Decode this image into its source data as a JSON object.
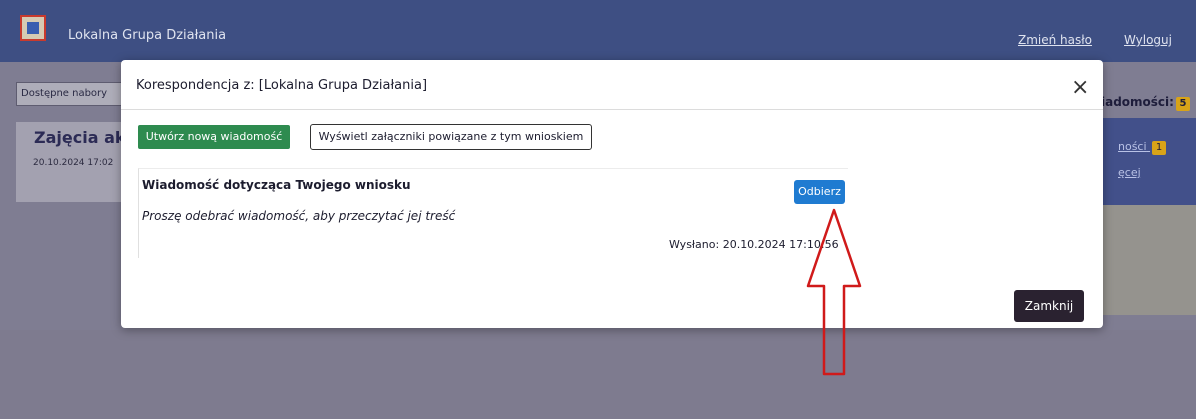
{
  "app": {
    "title": "Lokalna Grupa Działania",
    "change_password": "Zmień hasło",
    "logout": "Wyloguj"
  },
  "background": {
    "nav_button": "Dostępne nabory",
    "card_title": "Zajęcia akty",
    "card_date": "20.10.2024 17:02",
    "messages_label": "iadomości:",
    "messages_badge": "5",
    "side_link1": "ności",
    "side_link1_badge": "1",
    "side_link2": "ęcej"
  },
  "modal": {
    "title": "Korespondencja z: [Lokalna Grupa Działania]",
    "close_symbol": "×",
    "new_message_button": "Utwórz nową wiadomość",
    "attachments_button": "Wyświetl załączniki powiązane z tym wnioskiem",
    "message": {
      "subject": "Wiadomość dotycząca Twojego wniosku",
      "hint": "Proszę odebrać wiadomość, aby przeczytać jej treść",
      "receive_button": "Odbierz",
      "sent": "Wysłano: 20.10.2024 17:10:56"
    },
    "close_button": "Zamknij"
  },
  "colors": {
    "topbar": "#3e4f83",
    "primary_green": "#2e8b4f",
    "primary_blue": "#1f7bd1",
    "dark_button": "#2a2230",
    "annotation_red": "#d01a1a"
  },
  "icons": {
    "logo": "lgd-logo-icon",
    "close": "close-icon",
    "annotation": "up-arrow-icon"
  }
}
